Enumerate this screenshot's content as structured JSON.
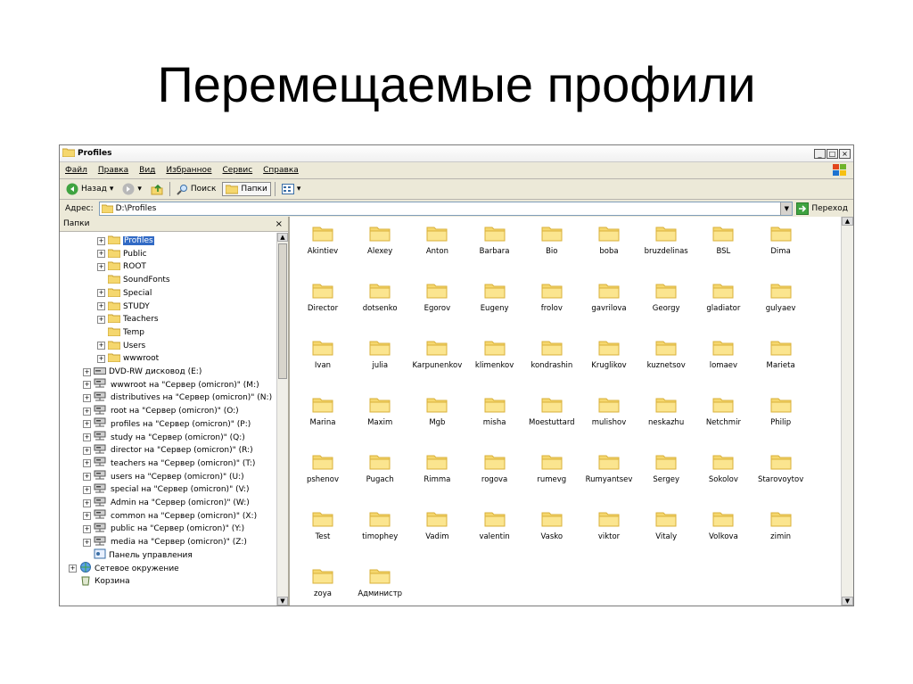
{
  "slide": {
    "title": "Перемещаемые профили"
  },
  "window": {
    "title": "Profiles",
    "menu": [
      "Файл",
      "Правка",
      "Вид",
      "Избранное",
      "Сервис",
      "Справка"
    ],
    "toolbar": {
      "back": "Назад",
      "search": "Поиск",
      "folders": "Папки"
    },
    "address": {
      "label": "Адрес:",
      "value": "D:\\Profiles",
      "go": "Переход"
    },
    "folders_pane": {
      "title": "Папки",
      "close": "×",
      "items": [
        {
          "label": "Profiles",
          "type": "folder"
        },
        {
          "label": "Public",
          "type": "folder"
        },
        {
          "label": "ROOT",
          "type": "folder"
        },
        {
          "label": "SoundFonts",
          "type": "folder"
        },
        {
          "label": "Special",
          "type": "folder"
        },
        {
          "label": "STUDY",
          "type": "folder"
        },
        {
          "label": "Teachers",
          "type": "folder"
        },
        {
          "label": "Temp",
          "type": "folder"
        },
        {
          "label": "Users",
          "type": "folder"
        },
        {
          "label": "wwwroot",
          "type": "folder"
        },
        {
          "label": "DVD-RW дисковод (E:)",
          "type": "drive"
        },
        {
          "label": "wwwroot на \"Сервер (omicron)\" (M:)",
          "type": "netdrive"
        },
        {
          "label": "distributives на \"Сервер (omicron)\" (N:)",
          "type": "netdrive"
        },
        {
          "label": "root на \"Сервер (omicron)\" (O:)",
          "type": "netdrive"
        },
        {
          "label": "profiles на \"Сервер (omicron)\" (P:)",
          "type": "netdrive"
        },
        {
          "label": "study на \"Сервер (omicron)\" (Q:)",
          "type": "netdrive"
        },
        {
          "label": "director на \"Сервер (omicron)\" (R:)",
          "type": "netdrive"
        },
        {
          "label": "teachers на \"Сервер (omicron)\" (T:)",
          "type": "netdrive"
        },
        {
          "label": "users на \"Сервер (omicron)\" (U:)",
          "type": "netdrive"
        },
        {
          "label": "special на \"Сервер (omicron)\" (V:)",
          "type": "netdrive"
        },
        {
          "label": "Admin на \"Сервер (omicron)\" (W:)",
          "type": "netdrive"
        },
        {
          "label": "common на \"Сервер (omicron)\" (X:)",
          "type": "netdrive"
        },
        {
          "label": "public на \"Сервер (omicron)\" (Y:)",
          "type": "netdrive"
        },
        {
          "label": "media на \"Сервер (omicron)\" (Z:)",
          "type": "netdrive"
        },
        {
          "label": "Панель управления",
          "type": "control"
        },
        {
          "label": "Сетевое окружение",
          "type": "network"
        },
        {
          "label": "Корзина",
          "type": "recycle"
        }
      ]
    },
    "files": [
      "Akintiev",
      "Alexey",
      "Anton",
      "Barbara",
      "Bio",
      "boba",
      "bruzdelinas",
      "BSL",
      "Dima",
      "Director",
      "dotsenko",
      "Egorov",
      "Eugeny",
      "frolov",
      "gavrilova",
      "Georgy",
      "gladiator",
      "gulyaev",
      "Ivan",
      "julia",
      "Karpunenkov",
      "klimenkov",
      "kondrashin",
      "Kruglikov",
      "kuznetsov",
      "lomaev",
      "Marieta",
      "Marina",
      "Maxim",
      "Mgb",
      "misha",
      "Moestuttard",
      "mulishov",
      "neskazhu",
      "Netchmir",
      "Philip",
      "pshenov",
      "Pugach",
      "Rimma",
      "rogova",
      "rumevg",
      "Rumyantsev",
      "Sergey",
      "Sokolov",
      "Starovoytov",
      "Test",
      "timophey",
      "Vadim",
      "valentin",
      "Vasko",
      "viktor",
      "Vitaly",
      "Volkova",
      "zimin",
      "zoya",
      "Администр"
    ],
    "colors": {
      "folder": "#f5d76e",
      "folder_dark": "#d9b03a",
      "selection": "#316ac5"
    }
  }
}
